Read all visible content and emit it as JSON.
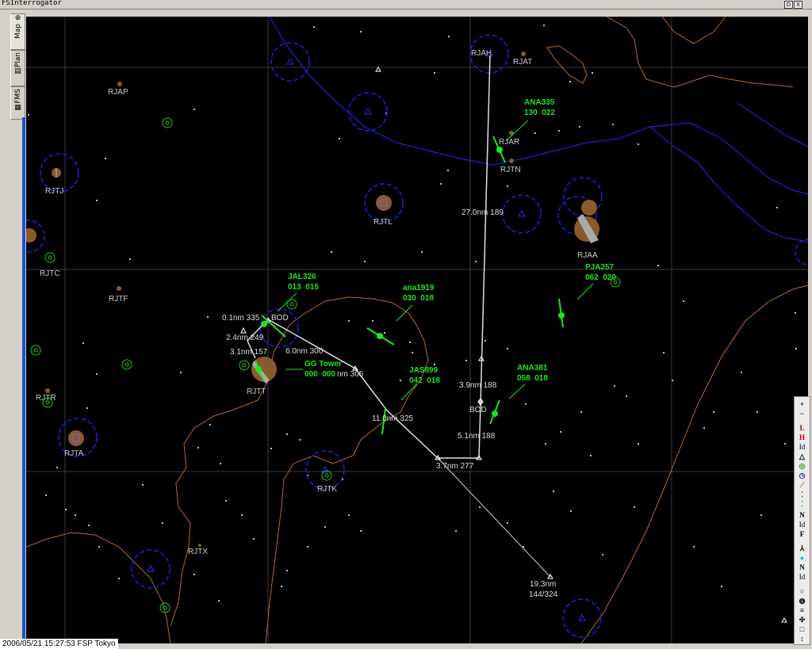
{
  "window": {
    "title": "FSInterrogator",
    "buttons": [
      "D",
      "X"
    ]
  },
  "tabs": [
    {
      "label": "Map",
      "icon": "⊕"
    },
    {
      "label": "Plan",
      "icon": "▤"
    },
    {
      "label": "FMS",
      "icon": "▦"
    }
  ],
  "status": {
    "timestamp": "2006/05/21 15:27:53 FSP Tokyo"
  },
  "colors": {
    "background": "#000000",
    "coast": "#b06a2a",
    "river": "#2020d0",
    "traffic": "#19e819",
    "route": "#e0e0e0",
    "ring": "#1f1fe0"
  },
  "airports": [
    {
      "id": "RJAH"
    },
    {
      "id": "RJAT"
    },
    {
      "id": "RJAP"
    },
    {
      "id": "RJAR"
    },
    {
      "id": "RJTN"
    },
    {
      "id": "RJTJ"
    },
    {
      "id": "RJTL"
    },
    {
      "id": "RJAA"
    },
    {
      "id": "RJTC"
    },
    {
      "id": "RJTF"
    },
    {
      "id": "RJTR"
    },
    {
      "id": "RJTA"
    },
    {
      "id": "RJTK"
    },
    {
      "id": "RJTT"
    },
    {
      "id": "RJTX"
    }
  ],
  "traffic": [
    {
      "callsign": "ANA335",
      "data": "130  022"
    },
    {
      "callsign": "JAL326",
      "data": "013  015"
    },
    {
      "callsign": "ana1919",
      "data": "030  018"
    },
    {
      "callsign": "PJA257",
      "data": "062  020"
    },
    {
      "callsign": "GG Tower",
      "data": "000  000"
    },
    {
      "callsign": "JAS899",
      "data": "042  018"
    },
    {
      "callsign": "ANA381",
      "data": "058  018"
    }
  ],
  "route_labels": [
    "27.0nm 189",
    "0.1nm 335",
    "BOD",
    "2.4nm 249",
    "3.1nm 157",
    "6.0nm 300",
    "nm 305",
    "11.0nm 325",
    "3.9nm 188",
    "BOD",
    "5.1nm 188",
    "3.7nm 277",
    "19.3nm",
    "144/324"
  ],
  "toolbar": [
    "+",
    "−",
    "L",
    "H",
    "Id",
    "△",
    "◎",
    "◷",
    "⟋",
    "⁚",
    "⁚",
    "N",
    "Id",
    "F",
    "⅄",
    "●",
    "N",
    "Id",
    "○",
    "◍",
    "≡",
    "✣",
    "□",
    "↕"
  ]
}
